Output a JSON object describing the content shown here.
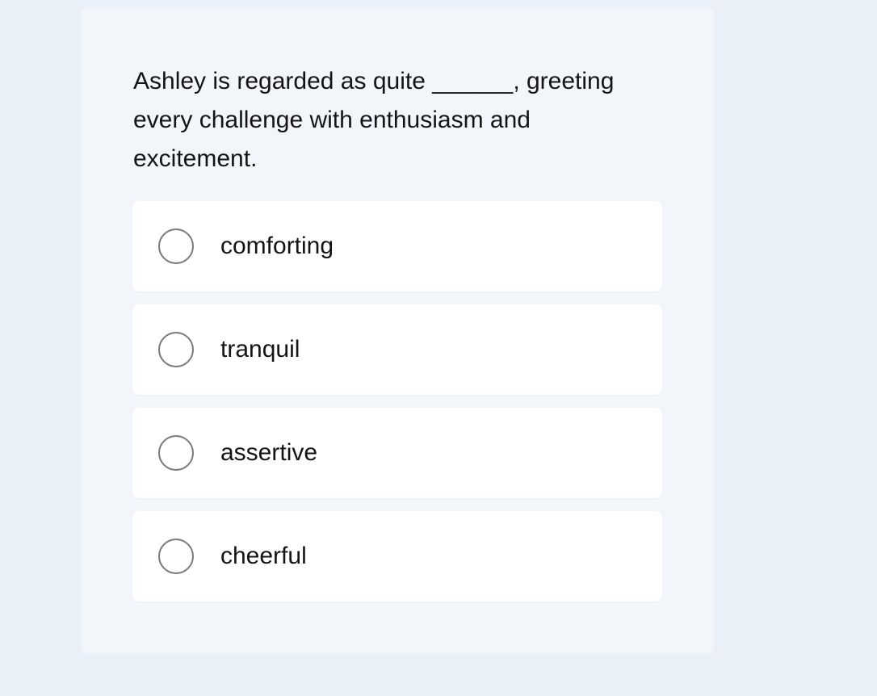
{
  "question": {
    "text": "Ashley is regarded as quite ______, greeting every challenge with enthusiasm and excitement."
  },
  "options": [
    {
      "label": "comforting",
      "selected": false
    },
    {
      "label": "tranquil",
      "selected": false
    },
    {
      "label": "assertive",
      "selected": false
    },
    {
      "label": "cheerful",
      "selected": false
    }
  ]
}
